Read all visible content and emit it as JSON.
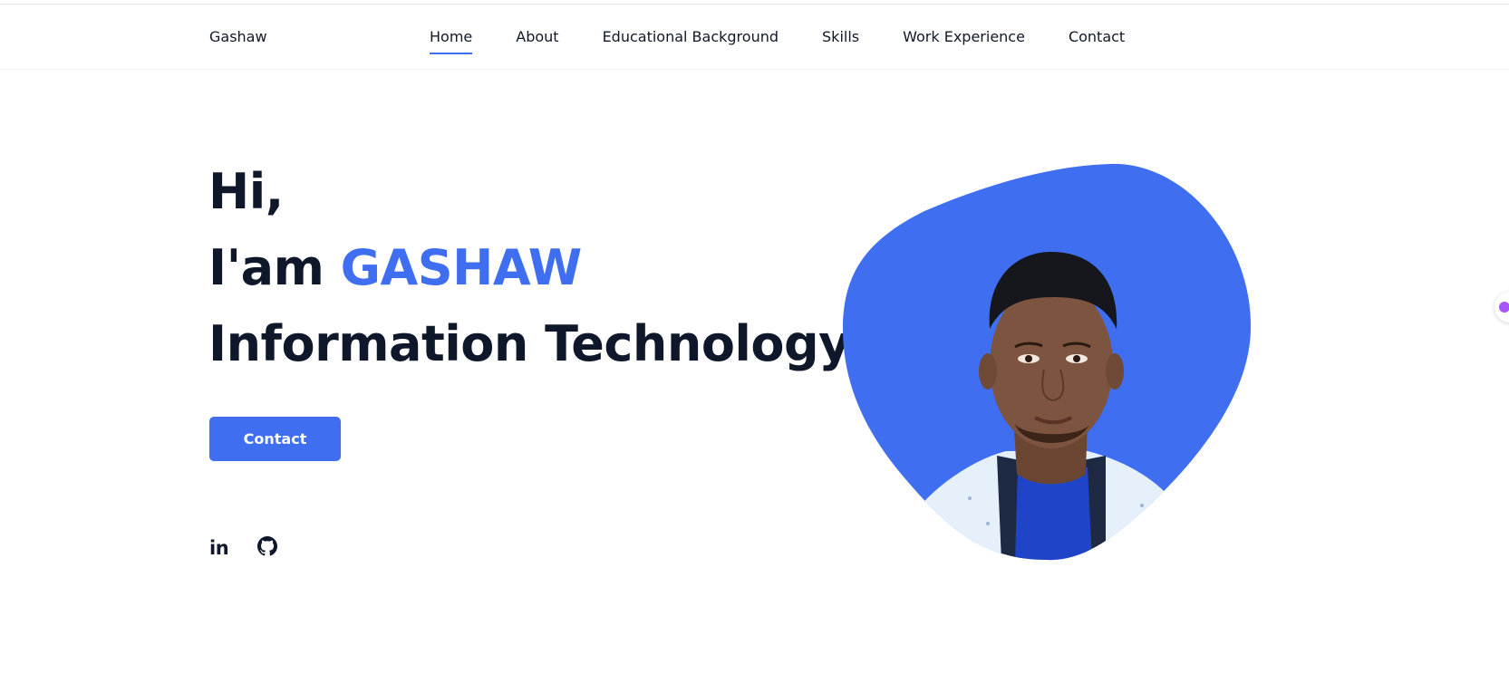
{
  "header": {
    "brand": "Gashaw",
    "nav_items": [
      {
        "label": "Home",
        "active": true
      },
      {
        "label": "About",
        "active": false
      },
      {
        "label": "Educational Background",
        "active": false
      },
      {
        "label": "Skills",
        "active": false
      },
      {
        "label": "Work Experience",
        "active": false
      },
      {
        "label": "Contact",
        "active": false
      }
    ]
  },
  "hero": {
    "line1": "Hi,",
    "line2_prefix": "I'am",
    "name": "GASHAW",
    "line3": "Information Technology",
    "contact_button": "Contact"
  },
  "social": {
    "linkedin_label": "in",
    "icons": [
      "linkedin-icon",
      "github-icon"
    ]
  },
  "profile": {
    "image_alt": "profile photo",
    "blob_color": "#3f6ff0"
  },
  "colors": {
    "accent": "#3f6ff0",
    "text": "#0f172a"
  }
}
